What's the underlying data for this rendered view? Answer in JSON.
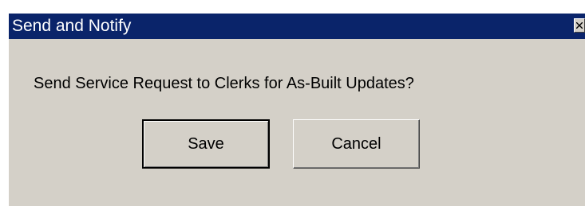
{
  "window": {
    "title": "Send and Notify",
    "close_icon": "close-icon"
  },
  "dialog": {
    "message": "Send Service Request to Clerks for As-Built Updates?"
  },
  "buttons": {
    "save_label": "Save",
    "cancel_label": "Cancel"
  },
  "colors": {
    "titlebar": "#0a246a",
    "title_text": "#ffffff",
    "dialog_background": "#d4d0c8"
  }
}
